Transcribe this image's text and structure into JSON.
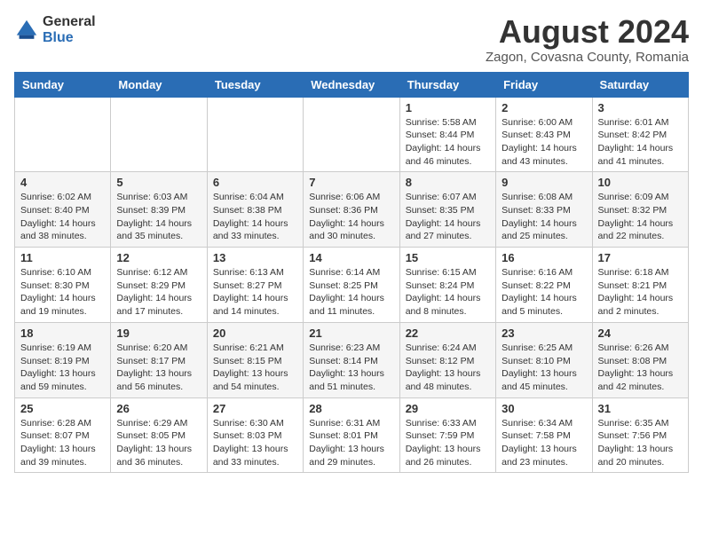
{
  "logo": {
    "general": "General",
    "blue": "Blue"
  },
  "title": {
    "month_year": "August 2024",
    "location": "Zagon, Covasna County, Romania"
  },
  "headers": [
    "Sunday",
    "Monday",
    "Tuesday",
    "Wednesday",
    "Thursday",
    "Friday",
    "Saturday"
  ],
  "weeks": [
    [
      {
        "day": "",
        "sunrise": "",
        "sunset": "",
        "daylight": ""
      },
      {
        "day": "",
        "sunrise": "",
        "sunset": "",
        "daylight": ""
      },
      {
        "day": "",
        "sunrise": "",
        "sunset": "",
        "daylight": ""
      },
      {
        "day": "",
        "sunrise": "",
        "sunset": "",
        "daylight": ""
      },
      {
        "day": "1",
        "sunrise": "Sunrise: 5:58 AM",
        "sunset": "Sunset: 8:44 PM",
        "daylight": "Daylight: 14 hours and 46 minutes."
      },
      {
        "day": "2",
        "sunrise": "Sunrise: 6:00 AM",
        "sunset": "Sunset: 8:43 PM",
        "daylight": "Daylight: 14 hours and 43 minutes."
      },
      {
        "day": "3",
        "sunrise": "Sunrise: 6:01 AM",
        "sunset": "Sunset: 8:42 PM",
        "daylight": "Daylight: 14 hours and 41 minutes."
      }
    ],
    [
      {
        "day": "4",
        "sunrise": "Sunrise: 6:02 AM",
        "sunset": "Sunset: 8:40 PM",
        "daylight": "Daylight: 14 hours and 38 minutes."
      },
      {
        "day": "5",
        "sunrise": "Sunrise: 6:03 AM",
        "sunset": "Sunset: 8:39 PM",
        "daylight": "Daylight: 14 hours and 35 minutes."
      },
      {
        "day": "6",
        "sunrise": "Sunrise: 6:04 AM",
        "sunset": "Sunset: 8:38 PM",
        "daylight": "Daylight: 14 hours and 33 minutes."
      },
      {
        "day": "7",
        "sunrise": "Sunrise: 6:06 AM",
        "sunset": "Sunset: 8:36 PM",
        "daylight": "Daylight: 14 hours and 30 minutes."
      },
      {
        "day": "8",
        "sunrise": "Sunrise: 6:07 AM",
        "sunset": "Sunset: 8:35 PM",
        "daylight": "Daylight: 14 hours and 27 minutes."
      },
      {
        "day": "9",
        "sunrise": "Sunrise: 6:08 AM",
        "sunset": "Sunset: 8:33 PM",
        "daylight": "Daylight: 14 hours and 25 minutes."
      },
      {
        "day": "10",
        "sunrise": "Sunrise: 6:09 AM",
        "sunset": "Sunset: 8:32 PM",
        "daylight": "Daylight: 14 hours and 22 minutes."
      }
    ],
    [
      {
        "day": "11",
        "sunrise": "Sunrise: 6:10 AM",
        "sunset": "Sunset: 8:30 PM",
        "daylight": "Daylight: 14 hours and 19 minutes."
      },
      {
        "day": "12",
        "sunrise": "Sunrise: 6:12 AM",
        "sunset": "Sunset: 8:29 PM",
        "daylight": "Daylight: 14 hours and 17 minutes."
      },
      {
        "day": "13",
        "sunrise": "Sunrise: 6:13 AM",
        "sunset": "Sunset: 8:27 PM",
        "daylight": "Daylight: 14 hours and 14 minutes."
      },
      {
        "day": "14",
        "sunrise": "Sunrise: 6:14 AM",
        "sunset": "Sunset: 8:25 PM",
        "daylight": "Daylight: 14 hours and 11 minutes."
      },
      {
        "day": "15",
        "sunrise": "Sunrise: 6:15 AM",
        "sunset": "Sunset: 8:24 PM",
        "daylight": "Daylight: 14 hours and 8 minutes."
      },
      {
        "day": "16",
        "sunrise": "Sunrise: 6:16 AM",
        "sunset": "Sunset: 8:22 PM",
        "daylight": "Daylight: 14 hours and 5 minutes."
      },
      {
        "day": "17",
        "sunrise": "Sunrise: 6:18 AM",
        "sunset": "Sunset: 8:21 PM",
        "daylight": "Daylight: 14 hours and 2 minutes."
      }
    ],
    [
      {
        "day": "18",
        "sunrise": "Sunrise: 6:19 AM",
        "sunset": "Sunset: 8:19 PM",
        "daylight": "Daylight: 13 hours and 59 minutes."
      },
      {
        "day": "19",
        "sunrise": "Sunrise: 6:20 AM",
        "sunset": "Sunset: 8:17 PM",
        "daylight": "Daylight: 13 hours and 56 minutes."
      },
      {
        "day": "20",
        "sunrise": "Sunrise: 6:21 AM",
        "sunset": "Sunset: 8:15 PM",
        "daylight": "Daylight: 13 hours and 54 minutes."
      },
      {
        "day": "21",
        "sunrise": "Sunrise: 6:23 AM",
        "sunset": "Sunset: 8:14 PM",
        "daylight": "Daylight: 13 hours and 51 minutes."
      },
      {
        "day": "22",
        "sunrise": "Sunrise: 6:24 AM",
        "sunset": "Sunset: 8:12 PM",
        "daylight": "Daylight: 13 hours and 48 minutes."
      },
      {
        "day": "23",
        "sunrise": "Sunrise: 6:25 AM",
        "sunset": "Sunset: 8:10 PM",
        "daylight": "Daylight: 13 hours and 45 minutes."
      },
      {
        "day": "24",
        "sunrise": "Sunrise: 6:26 AM",
        "sunset": "Sunset: 8:08 PM",
        "daylight": "Daylight: 13 hours and 42 minutes."
      }
    ],
    [
      {
        "day": "25",
        "sunrise": "Sunrise: 6:28 AM",
        "sunset": "Sunset: 8:07 PM",
        "daylight": "Daylight: 13 hours and 39 minutes."
      },
      {
        "day": "26",
        "sunrise": "Sunrise: 6:29 AM",
        "sunset": "Sunset: 8:05 PM",
        "daylight": "Daylight: 13 hours and 36 minutes."
      },
      {
        "day": "27",
        "sunrise": "Sunrise: 6:30 AM",
        "sunset": "Sunset: 8:03 PM",
        "daylight": "Daylight: 13 hours and 33 minutes."
      },
      {
        "day": "28",
        "sunrise": "Sunrise: 6:31 AM",
        "sunset": "Sunset: 8:01 PM",
        "daylight": "Daylight: 13 hours and 29 minutes."
      },
      {
        "day": "29",
        "sunrise": "Sunrise: 6:33 AM",
        "sunset": "Sunset: 7:59 PM",
        "daylight": "Daylight: 13 hours and 26 minutes."
      },
      {
        "day": "30",
        "sunrise": "Sunrise: 6:34 AM",
        "sunset": "Sunset: 7:58 PM",
        "daylight": "Daylight: 13 hours and 23 minutes."
      },
      {
        "day": "31",
        "sunrise": "Sunrise: 6:35 AM",
        "sunset": "Sunset: 7:56 PM",
        "daylight": "Daylight: 13 hours and 20 minutes."
      }
    ]
  ]
}
